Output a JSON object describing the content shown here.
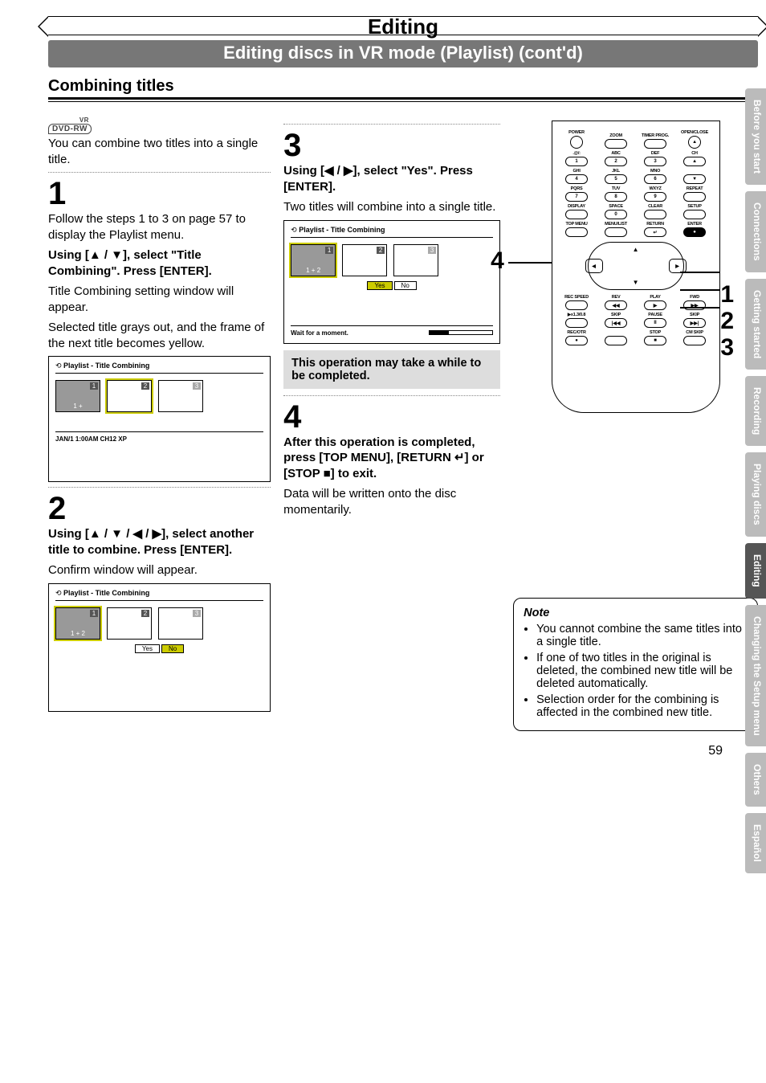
{
  "header": {
    "title": "Editing",
    "subtitle": "Editing discs in VR mode (Playlist) (cont'd)",
    "section": "Combining titles"
  },
  "badge": {
    "main": "DVD-RW",
    "sup": "VR"
  },
  "intro": "You can combine two titles into a single title.",
  "step1": {
    "num": "1",
    "p1": "Follow the steps 1 to 3 on page 57 to display the Playlist menu.",
    "p2": "Using [▲ / ▼], select \"Title Combining\". Press [ENTER].",
    "p3": "Title Combining setting window will appear.",
    "p4": "Selected title grays out, and the frame of the next title becomes yellow.",
    "screen": {
      "hdr": "Playlist - Title Combining",
      "thumbs": [
        {
          "num": "1",
          "txt": "1 +",
          "dark": true
        },
        {
          "num": "2",
          "sel": true
        },
        {
          "num": "3"
        }
      ],
      "status": "JAN/1 1:00AM CH12 XP"
    }
  },
  "step2": {
    "num": "2",
    "p1": "Using [▲ / ▼ / ◀ / ▶], select another title to combine. Press [ENTER].",
    "p2": "Confirm window will appear.",
    "screen": {
      "hdr": "Playlist - Title Combining",
      "thumbs": [
        {
          "num": "1",
          "txt": "1 + 2",
          "dark": true,
          "sel": true
        },
        {
          "num": "2"
        },
        {
          "num": "3"
        }
      ],
      "yes": "Yes",
      "no": "No"
    }
  },
  "step3": {
    "num": "3",
    "p1": "Using [◀ / ▶], select \"Yes\". Press [ENTER].",
    "p2": "Two titles will combine into a single title.",
    "screen": {
      "hdr": "Playlist - Title Combining",
      "thumbs": [
        {
          "num": "1",
          "txt": "1 + 2",
          "dark": true,
          "sel": true
        },
        {
          "num": "2"
        },
        {
          "num": "3"
        }
      ],
      "yes": "Yes",
      "no": "No",
      "wait": "Wait for a moment."
    },
    "greybox": "This operation may take a while to be completed."
  },
  "step4": {
    "num": "4",
    "p1": "After this operation is completed, press [TOP MENU], [RETURN ↵] or [STOP ■] to exit.",
    "p2": "Data will be written onto the disc momentarily."
  },
  "remote": {
    "row0": [
      "POWER",
      "",
      "TIMER PROG.",
      "OPEN/CLOSE"
    ],
    "row0b": [
      "",
      "ZOOM",
      "",
      ""
    ],
    "sym": {
      "eject": "▲",
      "chup": "▲",
      "chdn": "▼"
    },
    "rows": [
      [
        {
          "lbl": ".@/:",
          "n": "1"
        },
        {
          "lbl": "ABC",
          "n": "2"
        },
        {
          "lbl": "DEF",
          "n": "3"
        },
        {
          "lbl": "",
          "n": "▲",
          "small": "CH"
        }
      ],
      [
        {
          "lbl": "GHI",
          "n": "4"
        },
        {
          "lbl": "JKL",
          "n": "5"
        },
        {
          "lbl": "MNO",
          "n": "6"
        },
        {
          "lbl": "",
          "n": "▼"
        }
      ],
      [
        {
          "lbl": "PQRS",
          "n": "7"
        },
        {
          "lbl": "TUV",
          "n": "8"
        },
        {
          "lbl": "WXYZ",
          "n": "9"
        },
        {
          "lbl": "REPEAT",
          "n": ""
        }
      ],
      [
        {
          "lbl": "DISPLAY",
          "n": ""
        },
        {
          "lbl": "SPACE",
          "n": "0"
        },
        {
          "lbl": "CLEAR",
          "n": ""
        },
        {
          "lbl": "SETUP",
          "n": ""
        }
      ]
    ],
    "menurow": [
      "TOP MENU",
      "MENU/LIST",
      "RETURN",
      "ENTER"
    ],
    "transport1": [
      "REC SPEED",
      "REV",
      "PLAY",
      "FWD"
    ],
    "transport1s": [
      "",
      "◀◀",
      "▶",
      "▶▶"
    ],
    "transport2": [
      "▶x1.3/0.8",
      "SKIP",
      "PAUSE",
      "SKIP"
    ],
    "transport2s": [
      "",
      "|◀◀",
      "II",
      "▶▶|"
    ],
    "transport3": [
      "REC/OTR",
      "",
      "STOP",
      "CM SKIP"
    ],
    "transport3s": [
      "●",
      "",
      "■",
      ""
    ]
  },
  "callout4": "4",
  "callout_nums": [
    "1",
    "2",
    "3"
  ],
  "note": {
    "title": "Note",
    "items": [
      "You cannot combine the same titles into a single title.",
      "If one of two titles in the original is deleted, the combined new title will be deleted automatically.",
      "Selection order for the combining is affected in the combined new title."
    ]
  },
  "tabs": [
    "Before you start",
    "Connections",
    "Getting started",
    "Recording",
    "Playing discs",
    "Editing",
    "Changing the Setup menu",
    "Others",
    "Español"
  ],
  "active_tab": "Editing",
  "page_number": "59"
}
